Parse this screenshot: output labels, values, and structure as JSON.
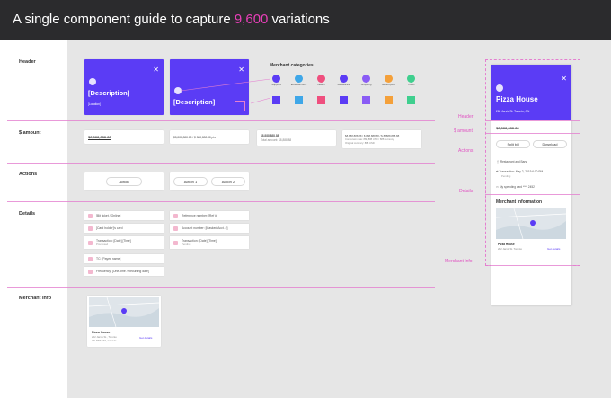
{
  "title": {
    "prefix": "A single component guide to capture ",
    "highlight": "9,600",
    "suffix": " variations"
  },
  "sections": {
    "header": "Header",
    "amount": "$ amount",
    "actions": "Actions",
    "details": "Details",
    "merchant": "Merchant Info"
  },
  "header_cards": {
    "desc": "[Description]",
    "location": "[Location]"
  },
  "categories": {
    "title": "Merchant categories",
    "items": [
      {
        "label": "Supplies",
        "color": "#5b3cf5"
      },
      {
        "label": "Entertainment",
        "color": "#3fa7e8"
      },
      {
        "label": "Health",
        "color": "#ef4f7e"
      },
      {
        "label": "Restaurant",
        "color": "#5b3cf5"
      },
      {
        "label": "Shopping",
        "color": "#8a5cf5"
      },
      {
        "label": "Subscription",
        "color": "#f4a03a"
      },
      {
        "label": "Travel",
        "color": "#3fcf8e"
      }
    ]
  },
  "amounts": {
    "a1": "$8,888,888.88",
    "a2": "$8,888,888.88 / $ 888,888.88 pts",
    "a3_main": "$8,888,888.88",
    "a3_sub": "Total amount: $8,888.88",
    "a4_main": "$8,888,888.88 / $ 888,888.88 / $ 88888,888.88",
    "a4_sub1": "Conversion rate: 888,888 USD / 888 currency",
    "a4_sub2": "Original currency: 888 USD"
  },
  "actions": {
    "single": "Action",
    "a1": "Action 1",
    "a2": "Action 2"
  },
  "details_left": [
    "[Bit ticket / Online]",
    "[Card holder]'s card",
    "Transaction: [Date] [Time]",
    "TC: [Payee name]",
    "Frequency: [One-time / Recurring date]"
  ],
  "details_left_sub": "Processed",
  "details_right": [
    "Reference number: [Ref #]",
    "Account number: [Masked Acct. #]",
    "Transaction: [Date] [Time]"
  ],
  "details_right_sub": "Pending",
  "merchant": {
    "name": "Pizza House",
    "addr1": "262 Jarvis St., Toronto",
    "addr2": "ON M5T 1T2, Canada",
    "link": "Get details"
  },
  "phone": {
    "title": "Pizza House",
    "address": "262 Jarvis St. Toronto, ON",
    "amount": "$8,888,888.88",
    "split": "Split bill",
    "download": "Download",
    "detail1": "Restaurant and Bars",
    "detail2": "Transaction: May 2, 2019 6:00 PM",
    "detail2_sub": "Pending",
    "detail3": "My spending card **** 2452",
    "merchant_title": "Merchant information",
    "merchant_name": "Pizza House",
    "merchant_addr": "262 Jarvis St. Toronto",
    "merchant_link": "Get details"
  },
  "labels": {
    "header": "Header",
    "amount": "$ amount",
    "actions": "Actions",
    "details": "Details",
    "merchant": "Merchant Info"
  }
}
